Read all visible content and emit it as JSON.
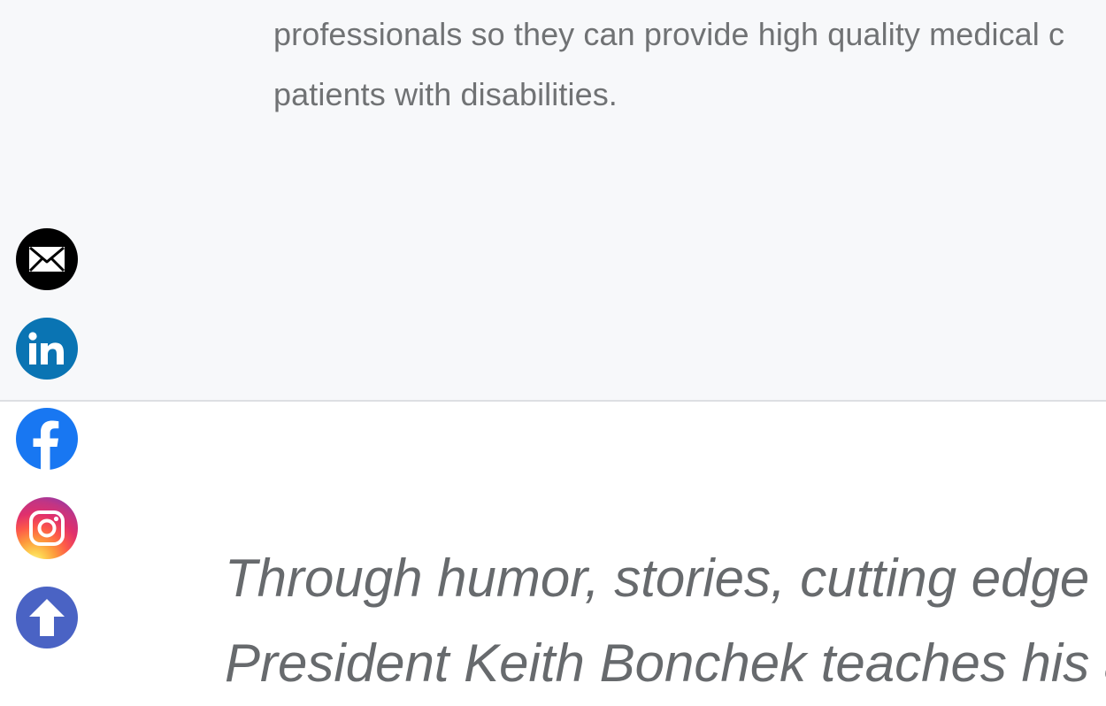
{
  "intro": {
    "lines": [
      "professionals so they can provide high quality medical c",
      "patients with disabilities."
    ]
  },
  "quote": {
    "lines": [
      "Through humor, stories, cutting edge t",
      "President Keith Bonchek teaches his a"
    ]
  },
  "social": {
    "items": [
      {
        "label": "Email",
        "icon": "envelope-icon",
        "color": "#000000"
      },
      {
        "label": "LinkedIn",
        "icon": "linkedin-icon",
        "color": "#0a74b3"
      },
      {
        "label": "Facebook",
        "icon": "facebook-icon",
        "color": "#1877f2"
      },
      {
        "label": "Instagram",
        "icon": "instagram-icon",
        "color": "#e1306c"
      },
      {
        "label": "Back to top",
        "icon": "arrow-up-icon",
        "color": "#4a63c4"
      }
    ]
  }
}
